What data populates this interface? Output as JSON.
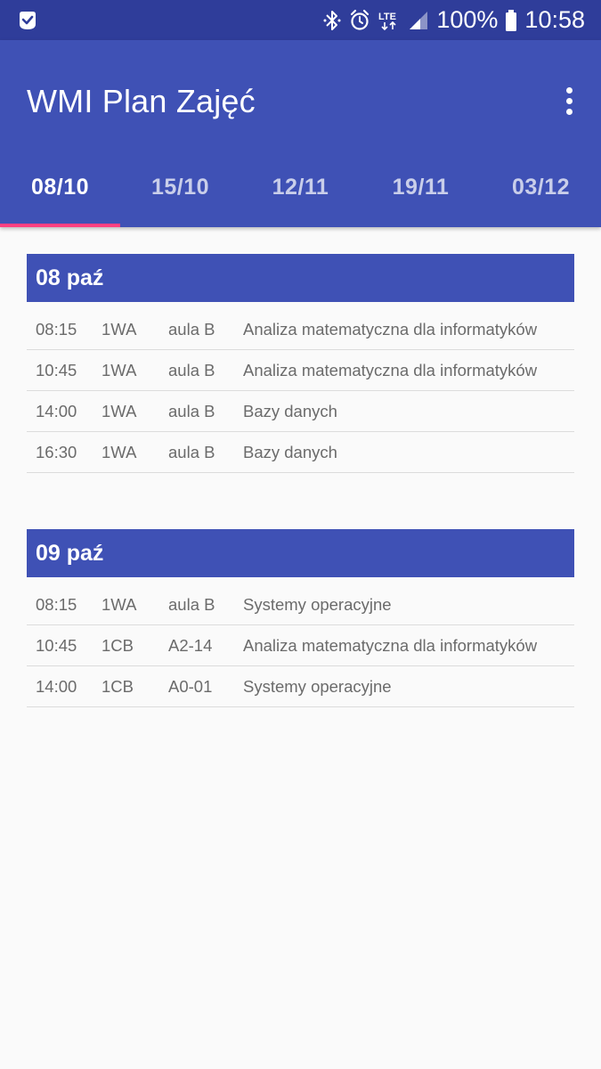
{
  "status_bar": {
    "battery": "100%",
    "time": "10:58",
    "network": "LTE",
    "icons": [
      "app-notification-icon",
      "bluetooth-icon",
      "alarm-icon",
      "lte-icon",
      "signal-icon",
      "battery-icon"
    ]
  },
  "app_bar": {
    "title": "WMI Plan Zajęć",
    "menu_icon": "overflow-menu-icon"
  },
  "tabs": [
    {
      "label": "08/10",
      "active": true
    },
    {
      "label": "15/10",
      "active": false
    },
    {
      "label": "12/11",
      "active": false
    },
    {
      "label": "19/11",
      "active": false
    },
    {
      "label": "03/12",
      "active": false
    }
  ],
  "days": [
    {
      "header": "08 paź",
      "classes": [
        {
          "time": "08:15",
          "group": "1WA",
          "room": "aula B",
          "subject": "Analiza matematyczna dla informatyków"
        },
        {
          "time": "10:45",
          "group": "1WA",
          "room": "aula B",
          "subject": "Analiza matematyczna dla informatyków"
        },
        {
          "time": "14:00",
          "group": "1WA",
          "room": "aula B",
          "subject": "Bazy danych"
        },
        {
          "time": "16:30",
          "group": "1WA",
          "room": "aula B",
          "subject": "Bazy danych"
        }
      ]
    },
    {
      "header": "09 paź",
      "classes": [
        {
          "time": "08:15",
          "group": "1WA",
          "room": "aula B",
          "subject": "Systemy operacyjne"
        },
        {
          "time": "10:45",
          "group": "1CB",
          "room": "A2-14",
          "subject": "Analiza matematyczna dla informatyków"
        },
        {
          "time": "14:00",
          "group": "1CB",
          "room": "A0-01",
          "subject": "Systemy operacyjne"
        }
      ]
    }
  ],
  "colors": {
    "primary": "#3f51b5",
    "primary_dark": "#2f3d9a",
    "accent": "#ff4081",
    "background": "#fafafa",
    "row_text": "#6b6b6b"
  }
}
